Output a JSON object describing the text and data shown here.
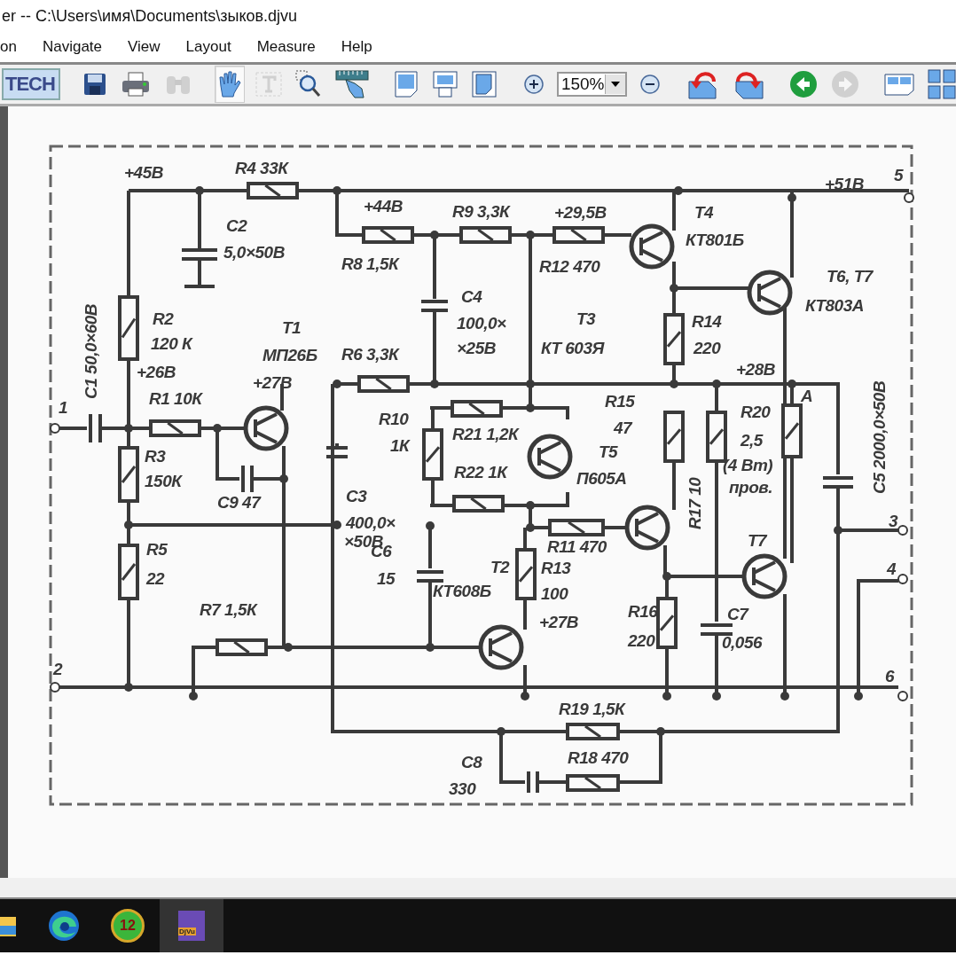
{
  "window": {
    "title": "er -- C:\\Users\\имя\\Documents\\зыков.djvu"
  },
  "menu": [
    "on",
    "Navigate",
    "View",
    "Layout",
    "Measure",
    "Help"
  ],
  "toolbar": [
    {
      "kind": "logo",
      "text": "TECH"
    },
    {
      "kind": "separator"
    },
    {
      "kind": "button",
      "selected": false,
      "disabled": false
    },
    {
      "kind": "button",
      "selected": false,
      "disabled": false
    },
    {
      "kind": "button",
      "selected": false,
      "disabled": true
    },
    {
      "kind": "separator"
    },
    {
      "kind": "button",
      "selected": true,
      "disabled": false
    },
    {
      "kind": "button",
      "selected": false,
      "disabled": true
    },
    {
      "kind": "button",
      "selected": false,
      "disabled": false
    },
    {
      "kind": "button",
      "selected": false,
      "disabled": false
    },
    {
      "kind": "separator"
    },
    {
      "kind": "button",
      "selected": false,
      "disabled": false
    },
    {
      "kind": "button",
      "selected": false,
      "disabled": false
    },
    {
      "kind": "button",
      "selected": false,
      "disabled": false
    },
    {
      "kind": "separator"
    },
    {
      "kind": "button",
      "selected": false,
      "disabled": false
    },
    {
      "kind": "combo",
      "value": "150%"
    },
    {
      "kind": "button",
      "selected": false,
      "disabled": false
    },
    {
      "kind": "separator"
    },
    {
      "kind": "button",
      "selected": false,
      "disabled": false
    },
    {
      "kind": "button",
      "selected": false,
      "disabled": false
    },
    {
      "kind": "separator"
    },
    {
      "kind": "button",
      "selected": false,
      "disabled": false
    },
    {
      "kind": "button",
      "selected": false,
      "disabled": true
    },
    {
      "kind": "separator"
    },
    {
      "kind": "button",
      "selected": false,
      "disabled": false
    },
    {
      "kind": "button",
      "selected": false,
      "disabled": false
    }
  ],
  "schematic": {
    "labels": [
      "+45В",
      "R4 33К",
      "С2",
      "5,0×50В",
      "+44В",
      "R9 3,3К",
      "+29,5В",
      "Т4",
      "КТ801Б",
      "+51В",
      "5",
      "R8 1,5К",
      "R12 470",
      "С4",
      "100,0×",
      "×25В",
      "Т3",
      "КТ 603Я",
      "Т6, Т7",
      "КТ803А",
      "R14",
      "220",
      "R2",
      "120 К",
      "+26В",
      "Т1",
      "МП26Б",
      "+27В",
      "R6 3,3К",
      "+28В",
      "R15",
      "47",
      "R20",
      "2,5",
      "(4 Вт)",
      "пров.",
      "А",
      "R17 10",
      "С5 2000,0×50В",
      "С1 50,0×60В",
      "1",
      "R1 10К",
      "R10",
      "1К",
      "R21 1,2К",
      "R22 1К",
      "Т5",
      "П605А",
      "R3",
      "150К",
      "С9 47",
      "С3",
      "400,0×",
      "×50В",
      "3",
      "С6",
      "R11 470",
      "15",
      "Т2",
      "КТ608Б",
      "R13",
      "100",
      "+27В",
      "R5",
      "22",
      "Т7",
      "4",
      "R16",
      "220",
      "С7",
      "0,056",
      "R7 1,5К",
      "2",
      "6",
      "R19 1,5К",
      "С8",
      "330",
      "R18 470"
    ]
  },
  "taskbar": [
    {
      "selected": false
    },
    {
      "selected": false
    },
    {
      "selected": false,
      "badge": "12"
    },
    {
      "selected": true,
      "badge": "DjVu"
    }
  ]
}
